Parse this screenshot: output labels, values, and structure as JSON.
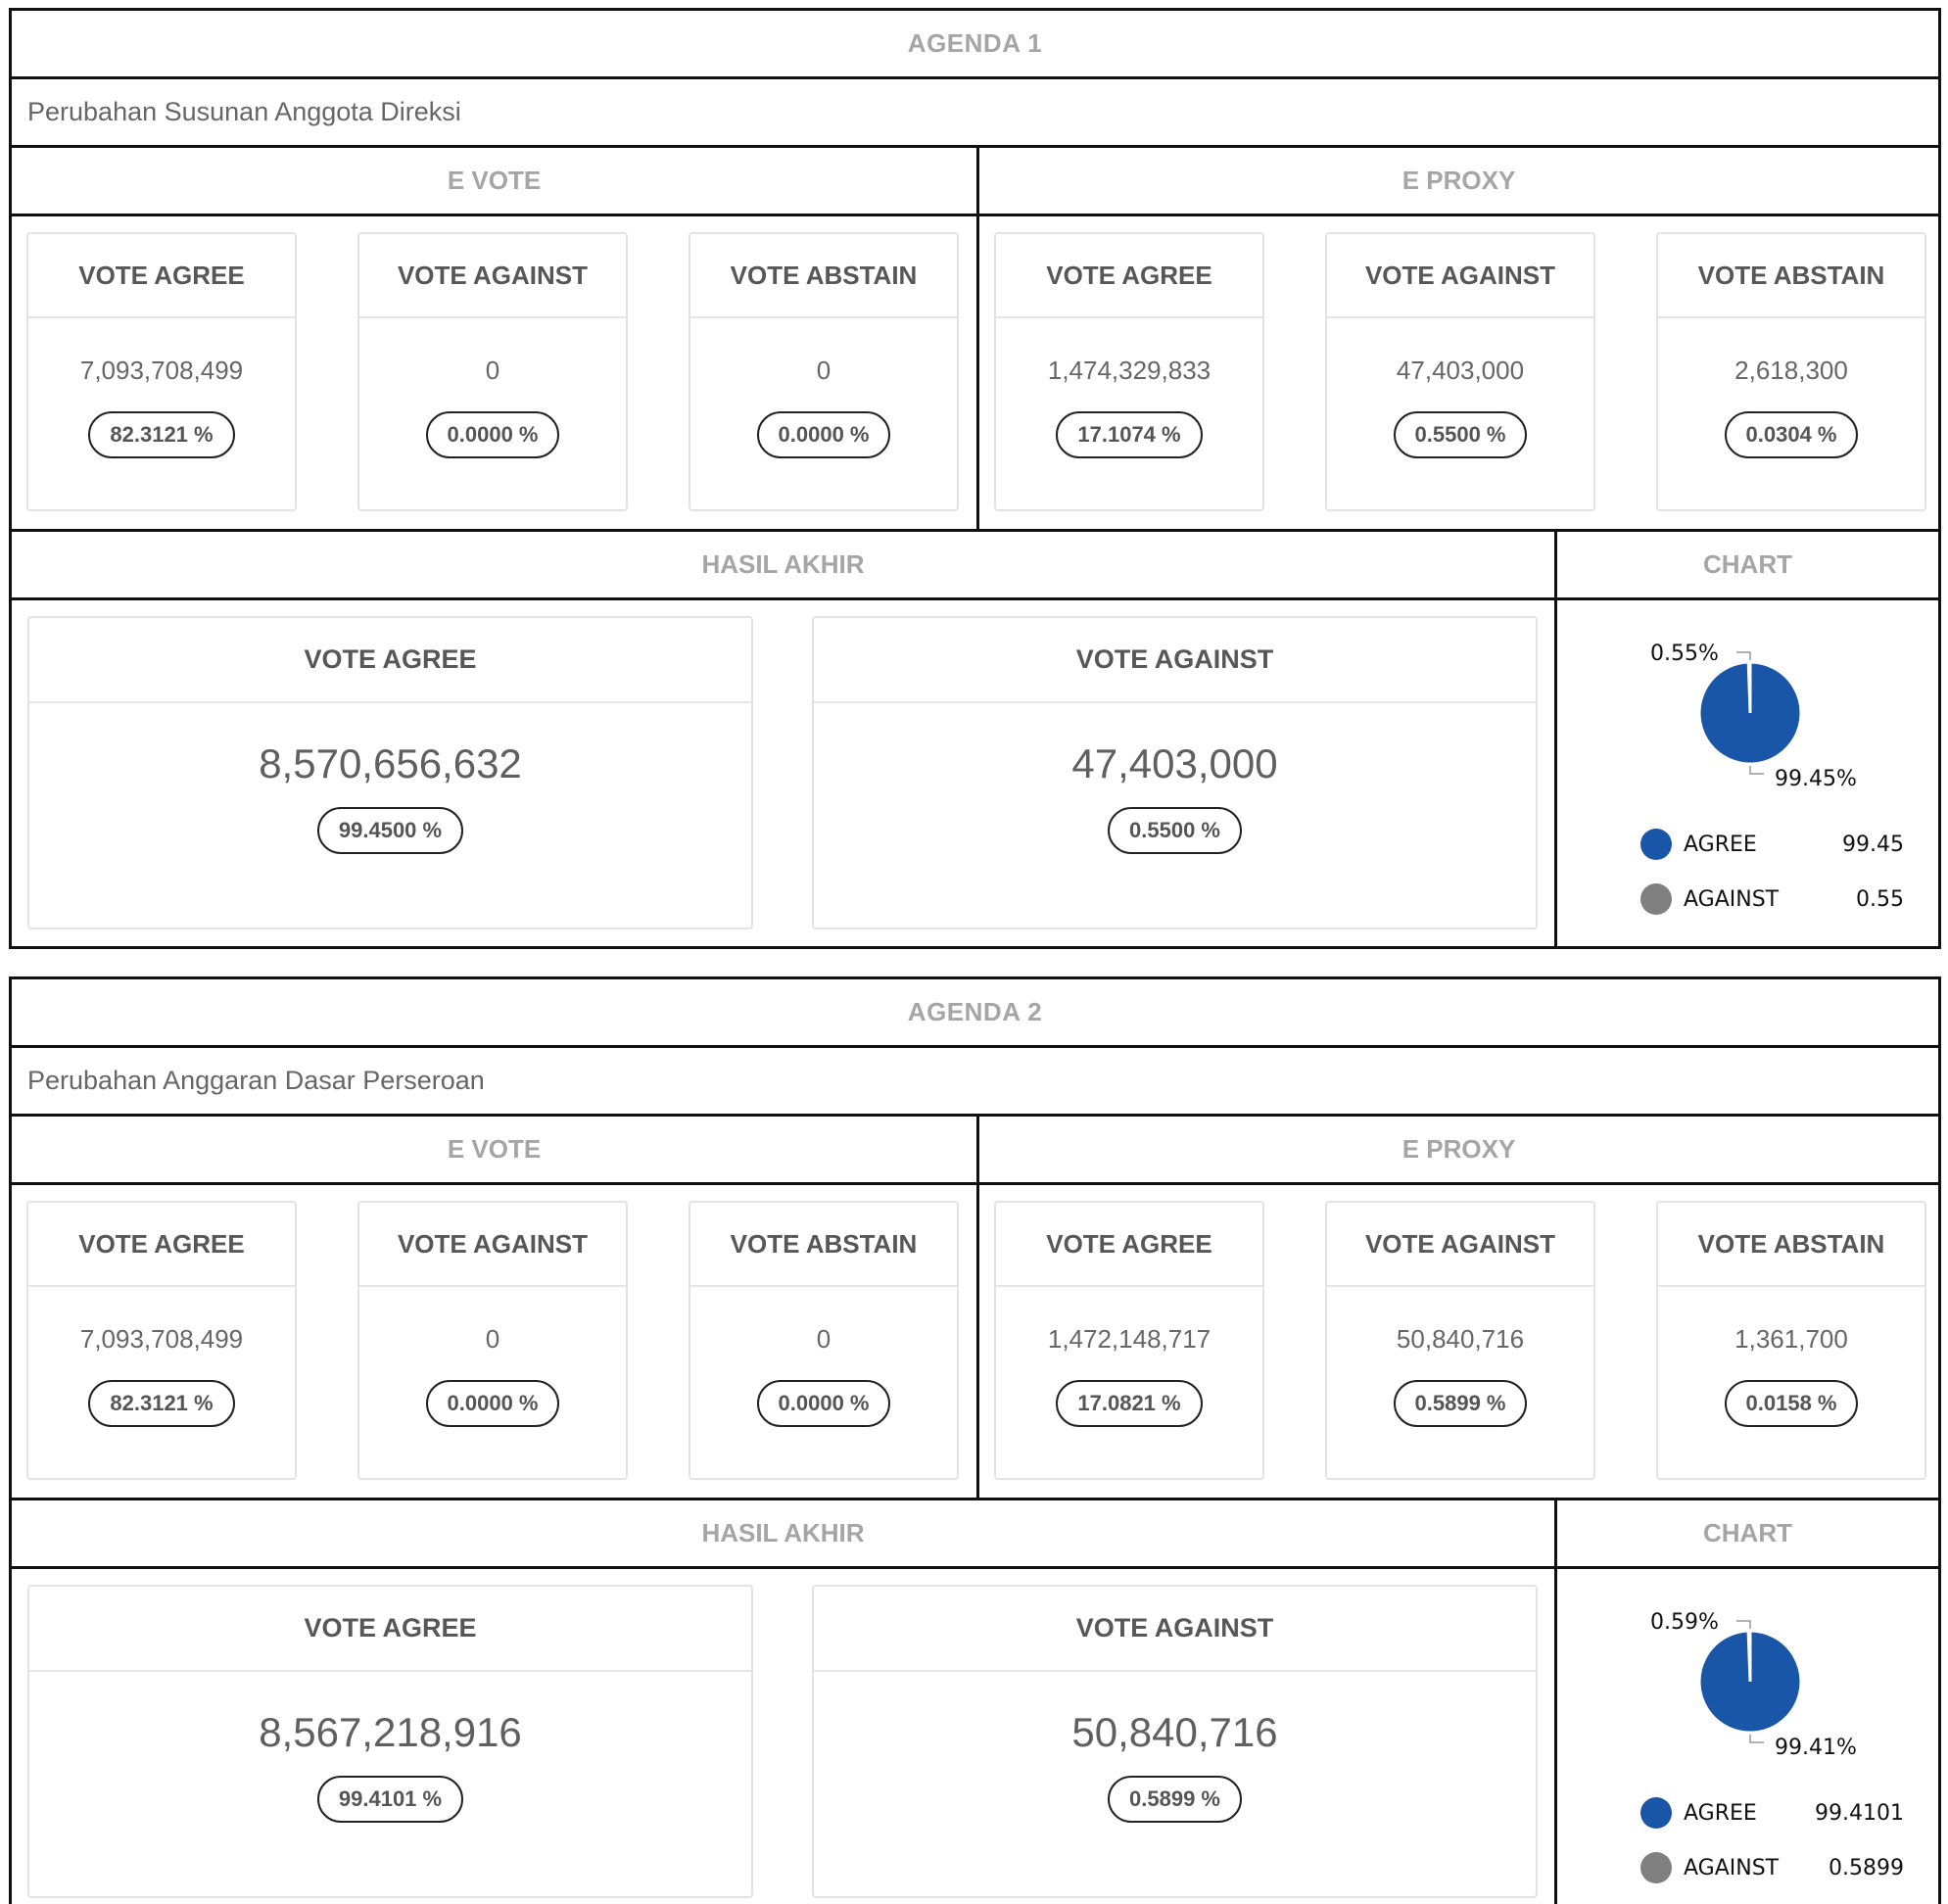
{
  "agendas": [
    {
      "title": "AGENDA 1",
      "description": "Perubahan Susunan Anggota Direksi",
      "evote_label": "E VOTE",
      "eproxy_label": "E PROXY",
      "evote": [
        {
          "label": "VOTE AGREE",
          "value": "7,093,708,499",
          "pct": "82.3121 %"
        },
        {
          "label": "VOTE AGAINST",
          "value": "0",
          "pct": "0.0000 %"
        },
        {
          "label": "VOTE ABSTAIN",
          "value": "0",
          "pct": "0.0000 %"
        }
      ],
      "eproxy": [
        {
          "label": "VOTE AGREE",
          "value": "1,474,329,833",
          "pct": "17.1074 %"
        },
        {
          "label": "VOTE AGAINST",
          "value": "47,403,000",
          "pct": "0.5500 %"
        },
        {
          "label": "VOTE ABSTAIN",
          "value": "2,618,300",
          "pct": "0.0304 %"
        }
      ],
      "hasil_label": "HASIL AKHIR",
      "chart_label": "CHART",
      "hasil": [
        {
          "label": "VOTE AGREE",
          "value": "8,570,656,632",
          "pct": "99.4500 %"
        },
        {
          "label": "VOTE AGAINST",
          "value": "47,403,000",
          "pct": "0.5500 %"
        }
      ],
      "chart_data": {
        "type": "pie",
        "slices": [
          {
            "name": "AGREE",
            "value": 99.45,
            "label": "99.45%",
            "legend_value": "99.45",
            "color": "#1a56a8"
          },
          {
            "name": "AGAINST",
            "value": 0.55,
            "label": "0.55%",
            "legend_value": "0.55",
            "color": "#808080"
          }
        ]
      }
    },
    {
      "title": "AGENDA 2",
      "description": "Perubahan Anggaran Dasar Perseroan",
      "evote_label": "E VOTE",
      "eproxy_label": "E PROXY",
      "evote": [
        {
          "label": "VOTE AGREE",
          "value": "7,093,708,499",
          "pct": "82.3121 %"
        },
        {
          "label": "VOTE AGAINST",
          "value": "0",
          "pct": "0.0000 %"
        },
        {
          "label": "VOTE ABSTAIN",
          "value": "0",
          "pct": "0.0000 %"
        }
      ],
      "eproxy": [
        {
          "label": "VOTE AGREE",
          "value": "1,472,148,717",
          "pct": "17.0821 %"
        },
        {
          "label": "VOTE AGAINST",
          "value": "50,840,716",
          "pct": "0.5899 %"
        },
        {
          "label": "VOTE ABSTAIN",
          "value": "1,361,700",
          "pct": "0.0158 %"
        }
      ],
      "hasil_label": "HASIL AKHIR",
      "chart_label": "CHART",
      "hasil": [
        {
          "label": "VOTE AGREE",
          "value": "8,567,218,916",
          "pct": "99.4101 %"
        },
        {
          "label": "VOTE AGAINST",
          "value": "50,840,716",
          "pct": "0.5899 %"
        }
      ],
      "chart_data": {
        "type": "pie",
        "slices": [
          {
            "name": "AGREE",
            "value": 99.41,
            "label": "99.41%",
            "legend_value": "99.4101",
            "color": "#1a56a8"
          },
          {
            "name": "AGAINST",
            "value": 0.59,
            "label": "0.59%",
            "legend_value": "0.5899",
            "color": "#808080"
          }
        ]
      }
    }
  ]
}
